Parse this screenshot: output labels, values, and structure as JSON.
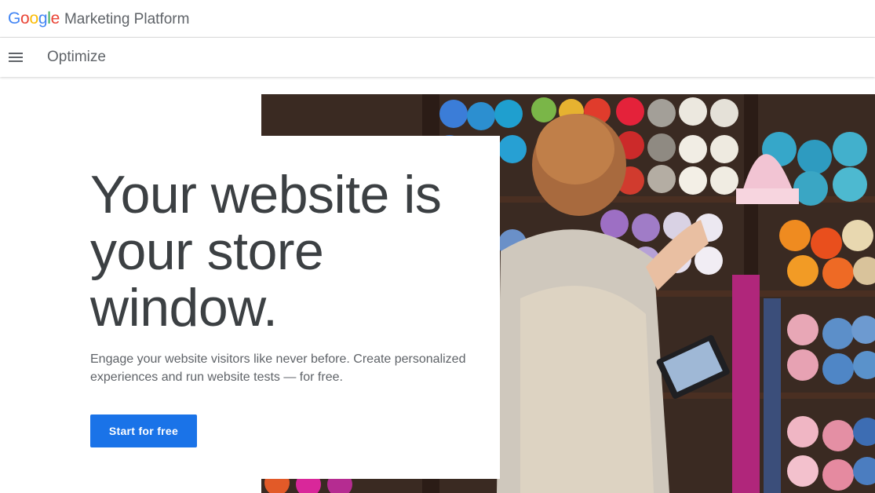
{
  "brand": {
    "logo_letters": [
      {
        "char": "G",
        "color": "#4285F4"
      },
      {
        "char": "o",
        "color": "#EA4335"
      },
      {
        "char": "o",
        "color": "#FBBC05"
      },
      {
        "char": "g",
        "color": "#4285F4"
      },
      {
        "char": "l",
        "color": "#34A853"
      },
      {
        "char": "e",
        "color": "#EA4335"
      }
    ],
    "platform": "Marketing Platform"
  },
  "product_bar": {
    "menu_icon": "hamburger-menu-icon",
    "product_name": "Optimize"
  },
  "hero": {
    "headline_lines": [
      "Your website is",
      "your store",
      "window."
    ],
    "subtext": "Engage your website visitors like never before. Create personalized experiences and run website tests — for free.",
    "cta_label": "Start for free",
    "image_description_icon": "yarn-shop-photo"
  },
  "colors": {
    "accent": "#1a73e8",
    "text_primary": "#3c4043",
    "text_secondary": "#5f6368"
  }
}
